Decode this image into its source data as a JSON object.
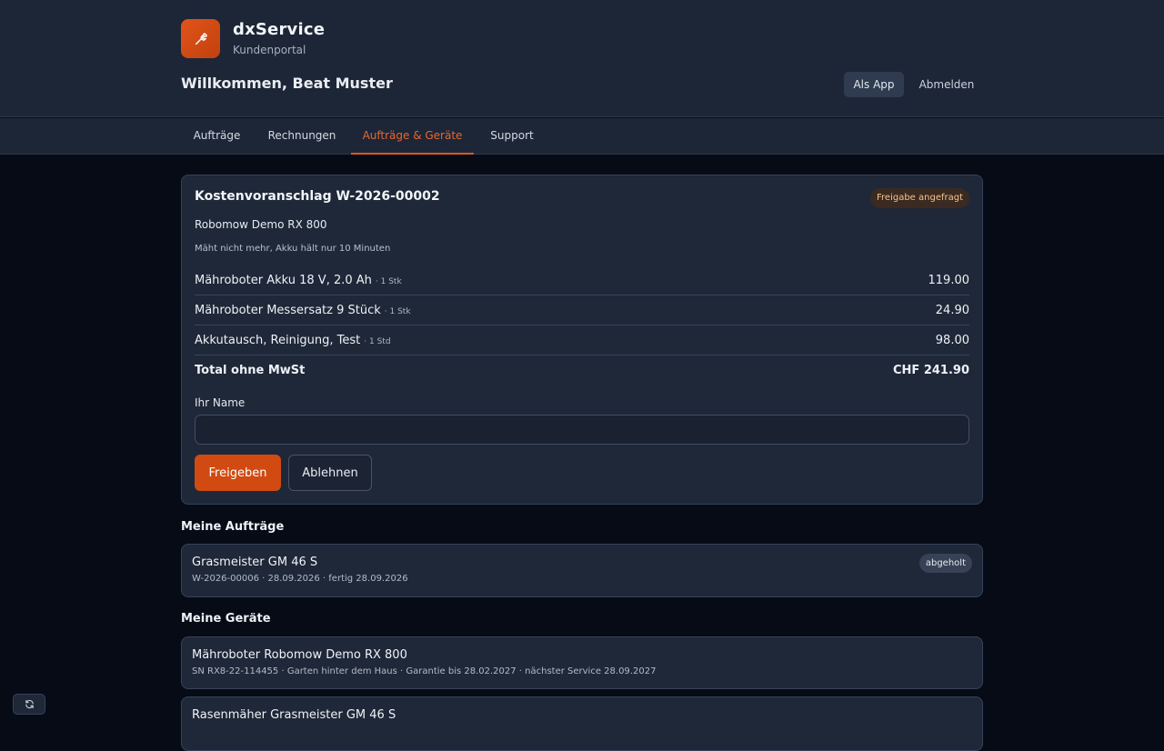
{
  "brand": {
    "name": "dxService",
    "subtitle": "Kundenportal"
  },
  "header": {
    "welcome": "Willkommen, Beat Muster",
    "app_button": "Als App",
    "logout_button": "Abmelden"
  },
  "nav": {
    "tabs": [
      "Aufträge",
      "Rechnungen",
      "Aufträge & Geräte",
      "Support"
    ],
    "active_tab": "Aufträge & Geräte"
  },
  "quote": {
    "title": "Kostenvoranschlag W-2026-00002",
    "status": "Freigabe angefragt",
    "device": "Robomow Demo RX 800",
    "issue": "Mäht nicht mehr, Akku hält nur 10 Minuten",
    "items": [
      {
        "name": "Mähroboter Akku 18 V, 2.0 Ah",
        "qty": "· 1 Stk",
        "price": "119.00"
      },
      {
        "name": "Mähroboter Messersatz 9 Stück",
        "qty": "· 1 Stk",
        "price": "24.90"
      },
      {
        "name": "Akkutausch, Reinigung, Test",
        "qty": "· 1 Std",
        "price": "98.00"
      }
    ],
    "total_label": "Total ohne MwSt",
    "total_value": "CHF 241.90",
    "name_label": "Ihr Name",
    "name_value": "",
    "approve_button": "Freigeben",
    "reject_button": "Ablehnen"
  },
  "orders": {
    "heading": "Meine Aufträge",
    "items": [
      {
        "title": "Grasmeister GM 46 S",
        "meta": "W-2026-00006 · 28.09.2026 · fertig 28.09.2026",
        "status": "abgeholt"
      }
    ]
  },
  "devices": {
    "heading": "Meine Geräte",
    "items": [
      {
        "title": "Mähroboter Robomow Demo RX 800",
        "meta": "SN RX8-22-114455 · Garten hinter dem Haus · Garantie bis 28.02.2027 · nächster Service 28.09.2027"
      },
      {
        "title": "Rasenmäher Grasmeister GM 46 S"
      }
    ]
  },
  "colors": {
    "accent": "#d14a12",
    "accent_text": "#e8662c",
    "background": "#060b16",
    "panel": "#1f2838",
    "header": "#1d2636"
  },
  "icons": {
    "logo": "wrench-icon",
    "refresh": "refresh-icon"
  }
}
